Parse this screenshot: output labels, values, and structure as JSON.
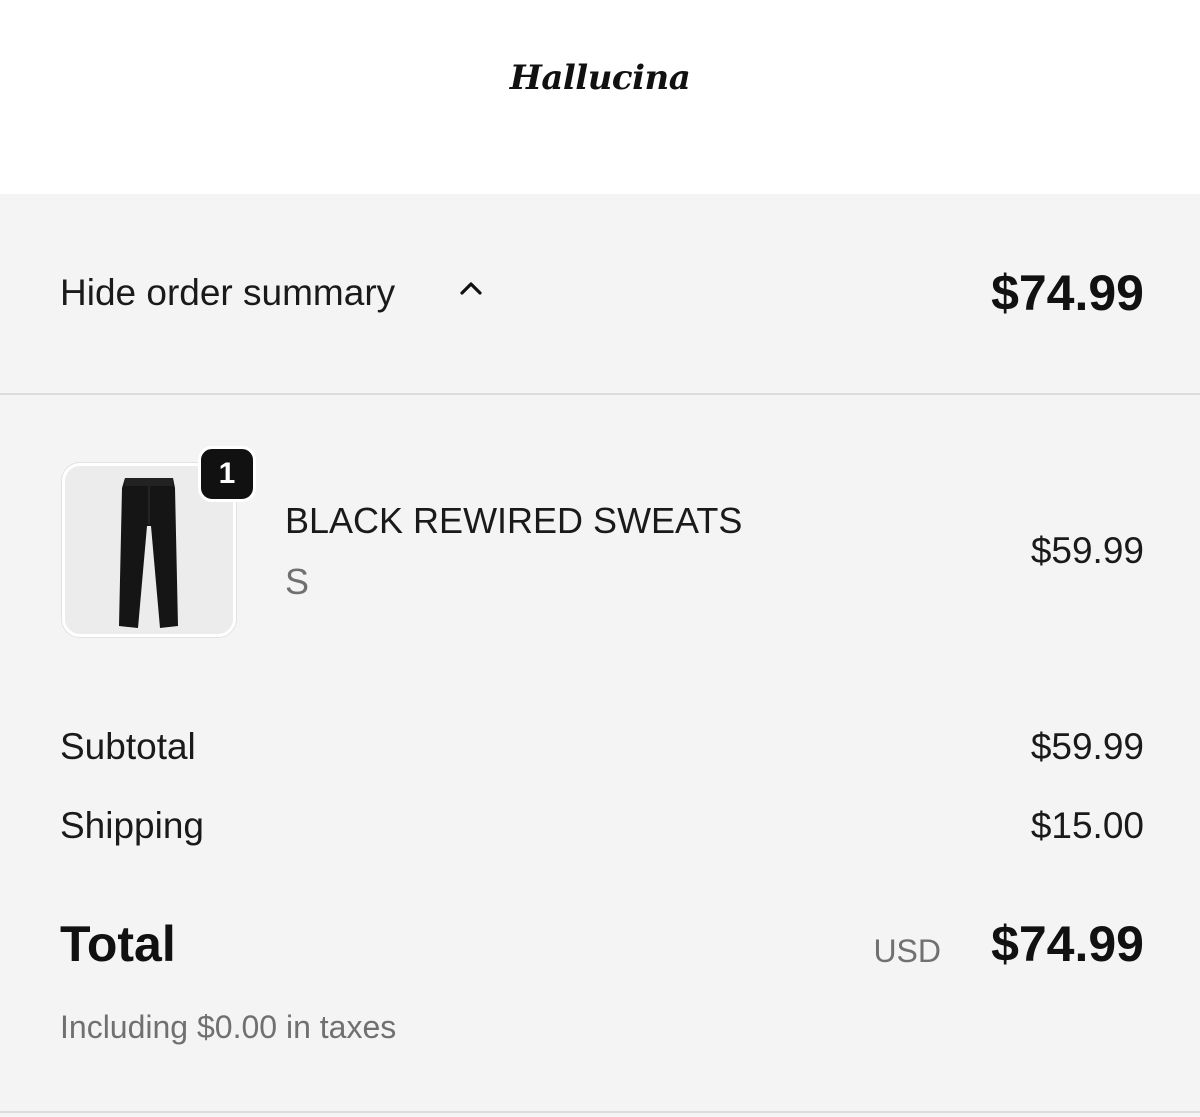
{
  "brand": {
    "logo_text": "Hallucina"
  },
  "summary_toggle": {
    "label": "Hide order summary",
    "icon": "chevron-up-icon",
    "total": "$74.99"
  },
  "line_items": [
    {
      "name": "BLACK REWIRED SWEATS",
      "variant": "S",
      "quantity": "1",
      "price": "$59.99",
      "image": "black-sweatpants-image"
    }
  ],
  "costs": {
    "subtotal_label": "Subtotal",
    "subtotal_value": "$59.99",
    "shipping_label": "Shipping",
    "shipping_value": "$15.00"
  },
  "total": {
    "label": "Total",
    "currency": "USD",
    "value": "$74.99",
    "taxes_note": "Including $0.00 in taxes"
  },
  "colors": {
    "page_background": "#f4f4f4",
    "header_background": "#ffffff",
    "primary_text": "#111111",
    "secondary_text": "#707070",
    "badge_background": "#111111"
  }
}
